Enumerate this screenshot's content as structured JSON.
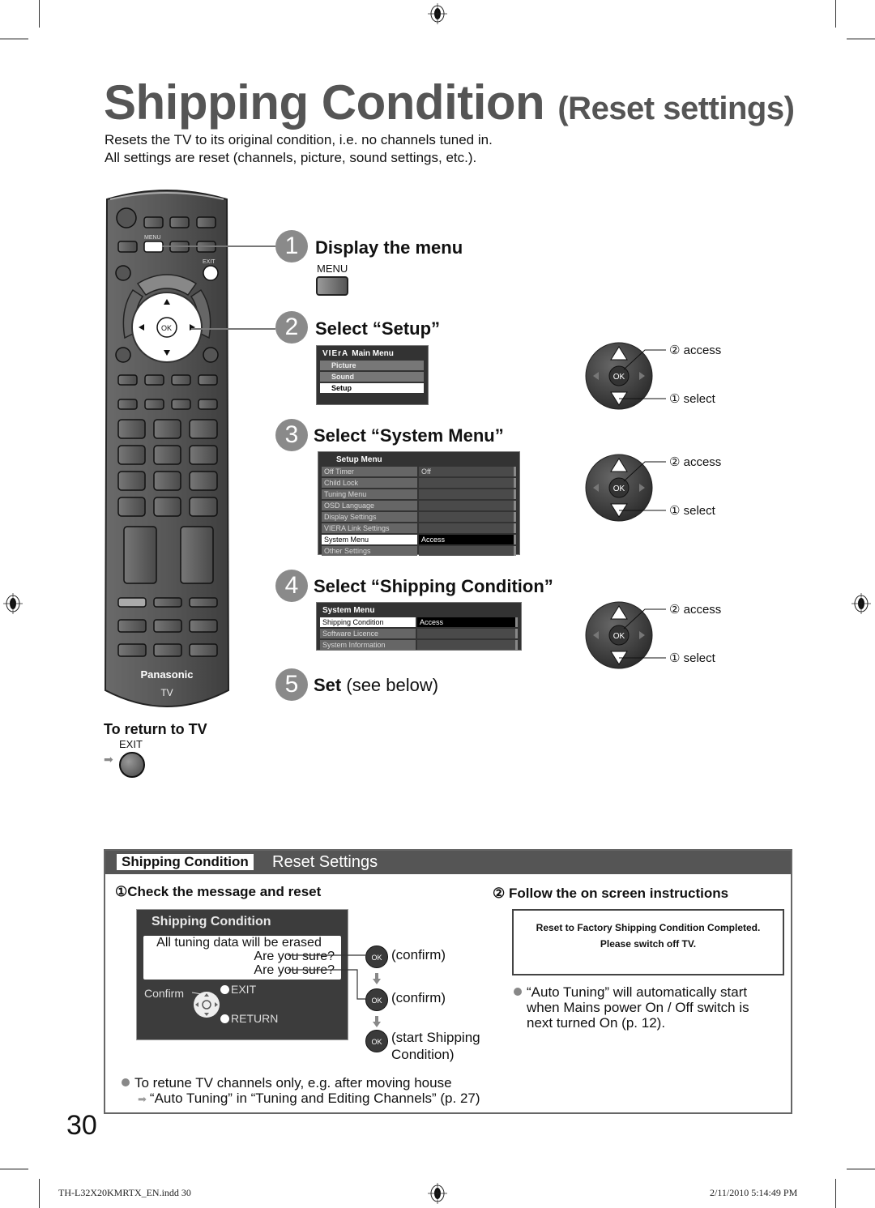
{
  "page": {
    "title": "Shipping Condition",
    "title_sub": "(Reset settings)",
    "intro": [
      "Resets the TV to its original condition, i.e. no channels tuned in.",
      "All settings are reset (channels, picture, sound settings, etc.)."
    ],
    "page_number": "30"
  },
  "remote": {
    "menu_label": "MENU",
    "exit_label": "EXIT",
    "ok_label": "OK",
    "brand": "Panasonic",
    "model": "TV"
  },
  "steps": [
    {
      "num": "1",
      "title": "Display the menu",
      "button_label": "MENU"
    },
    {
      "num": "2",
      "title": "Select “Setup”"
    },
    {
      "num": "3",
      "title": "Select “System Menu”"
    },
    {
      "num": "4",
      "title": "Select “Shipping Condition”"
    },
    {
      "num": "5",
      "title": "Set",
      "title_extra": "(see below)"
    }
  ],
  "main_menu": {
    "logo": "VIErA",
    "title": "Main Menu",
    "items": [
      "Picture",
      "Sound",
      "Setup"
    ],
    "selected": "Setup"
  },
  "setup_menu": {
    "title": "Setup Menu",
    "rows": [
      {
        "label": "Off Timer",
        "value": "Off"
      },
      {
        "label": "Child Lock",
        "value": ""
      },
      {
        "label": "Tuning Menu",
        "value": ""
      },
      {
        "label": "OSD Language",
        "value": ""
      },
      {
        "label": "Display Settings",
        "value": ""
      },
      {
        "label": "VIERA Link Settings",
        "value": ""
      },
      {
        "label": "System Menu",
        "value": "Access",
        "selected": true
      },
      {
        "label": "Other Settings",
        "value": ""
      }
    ]
  },
  "system_menu": {
    "title": "System Menu",
    "rows": [
      {
        "label": "Shipping Condition",
        "value": "Access",
        "selected": true
      },
      {
        "label": "Software Licence",
        "value": ""
      },
      {
        "label": "System Information",
        "value": ""
      }
    ]
  },
  "nav_pad": {
    "ok": "OK",
    "access": "② access",
    "select": "① select"
  },
  "return_tv": {
    "title": "To return to TV",
    "button_label": "EXIT"
  },
  "reset_section": {
    "tag": "Shipping Condition",
    "heading": "Reset Settings",
    "step1_title": "①Check the message and reset",
    "step2_title": "② Follow the on screen instructions",
    "dialog": {
      "title": "Shipping Condition",
      "lines": [
        "All tuning data will be erased",
        "Are you sure?",
        "Are you sure?"
      ],
      "confirm": "Confirm",
      "exit": "EXIT",
      "return": "RETURN"
    },
    "ok_actions": [
      "(confirm)",
      "(confirm)",
      "(start Shipping",
      "Condition)"
    ],
    "ok_label": "OK",
    "completed_msg": [
      "Reset to Factory Shipping Condition Completed.",
      "Please switch off TV."
    ],
    "auto_note": [
      "“Auto Tuning” will automatically start",
      "when Mains power On / Off switch is",
      "next turned On (p. 12)."
    ],
    "retune_note": "To retune TV channels only, e.g. after moving house",
    "retune_ref": "“Auto Tuning” in “Tuning and Editing Channels” (p. 27)"
  },
  "footer": {
    "file": "TH-L32X20KMRTX_EN.indd   30",
    "timestamp": "2/11/2010   5:14:49 PM"
  }
}
